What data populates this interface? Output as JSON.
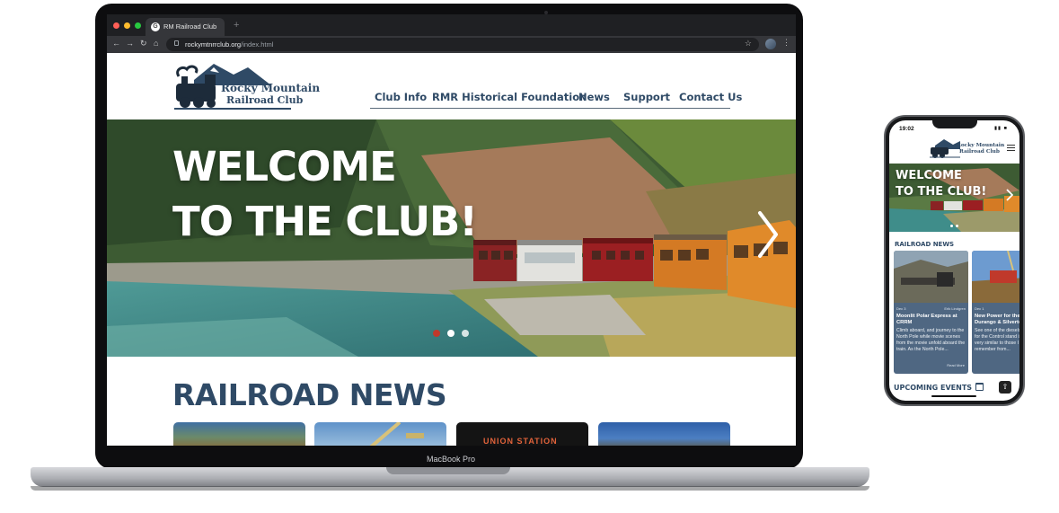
{
  "browser": {
    "tab_title": "RM Railroad Club",
    "url_domain": "rockymtnrrclub.org",
    "url_path": "/index.html"
  },
  "laptop": {
    "model_label": "MacBook Pro"
  },
  "site": {
    "logo": {
      "line1": "Rocky Mountain",
      "line2": "Railroad Club"
    },
    "nav": [
      "Club Info",
      "RMR Historical Foundation",
      "News",
      "Support",
      "Contact Us"
    ],
    "hero": {
      "line1": "WELCOME",
      "line2": "TO THE CLUB!",
      "active_slide": 1,
      "slide_count": 3
    },
    "news_heading": "RAILROAD NEWS",
    "news_thumb_sign": "UNION STATION"
  },
  "phone": {
    "time": "19:02",
    "hero": {
      "line1": "WELCOME",
      "line2": "TO THE CLUB!"
    },
    "news_heading": "RAILROAD NEWS",
    "cards": [
      {
        "date": "Dec 3",
        "author": "Erik Lindgren",
        "title": "Moonlit Polar Express at CRRM",
        "body": "Climb aboard, and journey to the North Pole while movie scenes from the movie unfold aboard the train. As the North Pole...",
        "more": "Read More"
      },
      {
        "date": "Dec 1",
        "author": "",
        "title": "New Power for the Durango & Silverton",
        "body": "See one of the diesels for for the Control stand is very similar to those I remember from...",
        "more": ""
      }
    ],
    "upcoming_heading": "UPCOMING EVENTS"
  },
  "colors": {
    "navy": "#2f4a66",
    "accent_red": "#c0392b",
    "card_blue": "#4f6782"
  }
}
